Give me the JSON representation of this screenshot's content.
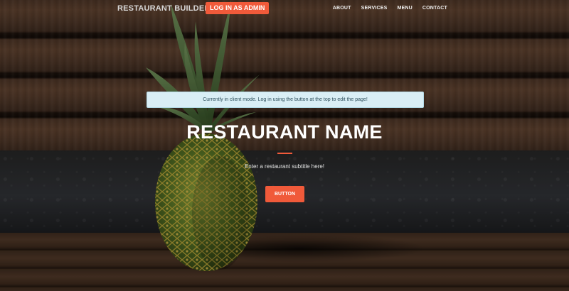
{
  "navbar": {
    "brand": "RESTAURANT BUILDER",
    "admin_button": "LOG IN AS ADMIN",
    "links": [
      "ABOUT",
      "SERVICES",
      "MENU",
      "CONTACT"
    ]
  },
  "alert": {
    "message": "Currently in client mode. Log in using the button at the top to edit the page!"
  },
  "hero": {
    "title": "RESTAURANT NAME",
    "subtitle": "Enter a restaurant subtitle here!",
    "button_label": "BUTTON",
    "background_image": "pineapple-on-wooden-bench"
  },
  "colors": {
    "accent": "#f05a3a",
    "alert_bg": "#d9eef5",
    "alert_text": "#2b4d5a",
    "title_text": "#ffffff"
  }
}
